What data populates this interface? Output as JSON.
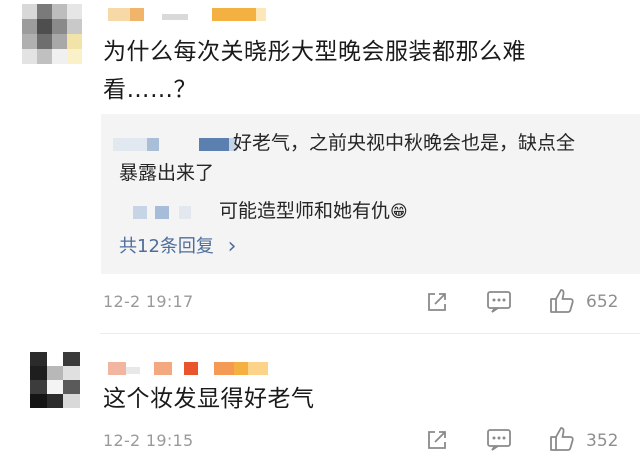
{
  "comments": [
    {
      "text_line1": "为什么每次关晓彤大型晚会服装都那么难",
      "text_line2": "看……？",
      "replies": {
        "reply1_line1": "好老气，之前央视中秋晚会也是，缺点全",
        "reply1_line2": "暴露出来了",
        "reply2": "可能造型师和她有仇",
        "reply2_emoji": "😁",
        "more_label": "共12条回复",
        "more_chevron": "›"
      },
      "time": "12-2 19:17",
      "likes": "652"
    },
    {
      "text": "这个妆发显得好老气",
      "time": "12-2 19:15",
      "likes": "352"
    }
  ],
  "icons": [
    "share-icon",
    "comment-icon",
    "like-icon",
    "chevron-right-icon"
  ],
  "colors": {
    "link": "#4f6d9c",
    "meta": "#9a9a9a",
    "reply_bg": "#f4f4f4",
    "name_orange": "#f5b042"
  }
}
